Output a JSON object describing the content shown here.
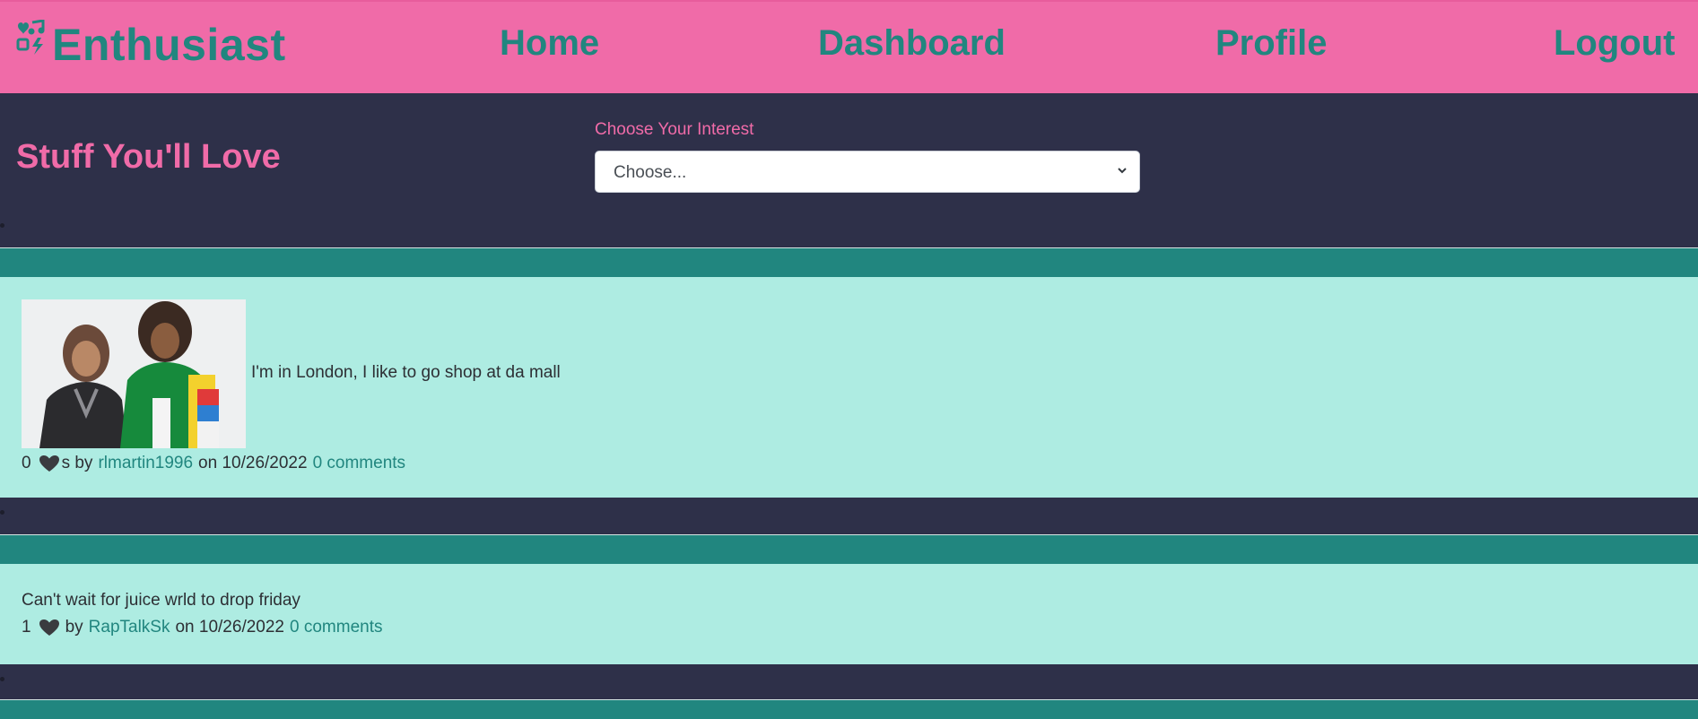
{
  "navbar": {
    "brand": "Enthusiast",
    "brand_icon": "heart-music-icon",
    "links": [
      "Home",
      "Dashboard",
      "Profile",
      "Logout"
    ],
    "colors": {
      "background": "#f06ba8",
      "text": "#21867f"
    }
  },
  "interest": {
    "title": "Stuff You'll Love",
    "label": "Choose Your Interest",
    "selected": "Choose..."
  },
  "posts": [
    {
      "has_image": true,
      "text": "I'm in London, I like to go shop at da mall",
      "likes": "0",
      "likes_suffix": "s by",
      "author": "rlmartin1996",
      "date_prefix": "on 10/26/2022",
      "comments": "0 comments"
    },
    {
      "has_image": false,
      "text": "Can't wait for juice wrld to drop friday",
      "likes": "1",
      "likes_suffix": "by",
      "author": "RapTalkSk",
      "date_prefix": "on 10/26/2022",
      "comments": "0 comments"
    }
  ],
  "colors": {
    "page_background": "#2e3049",
    "card_header": "#21867f",
    "card_body": "#aeece2",
    "accent_pink": "#f06ba8"
  }
}
